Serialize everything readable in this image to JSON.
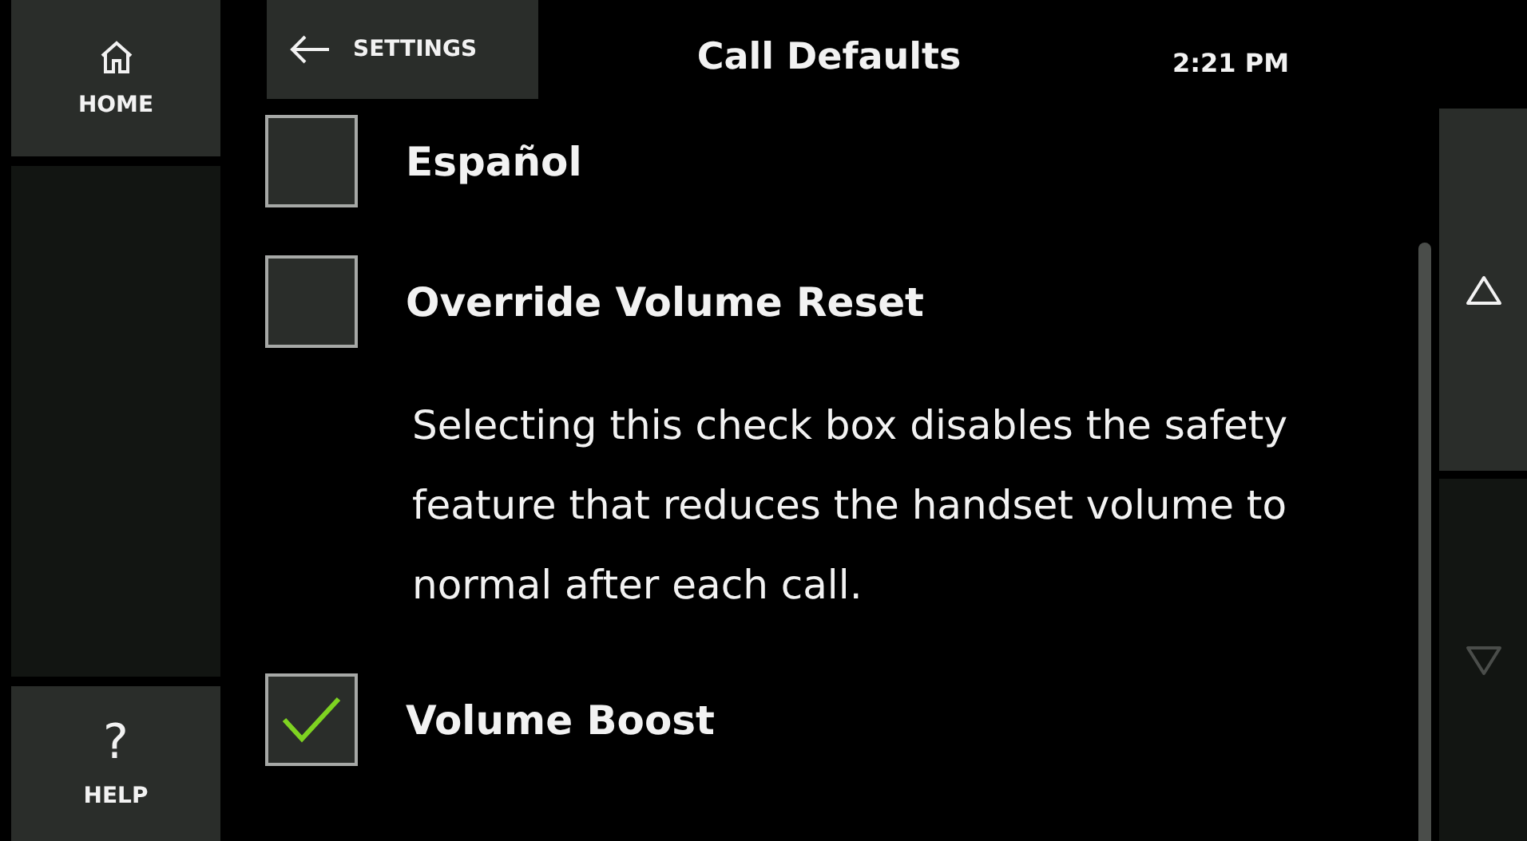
{
  "sidebar": {
    "items": [
      {
        "kind": "home",
        "label": "HOME"
      },
      {
        "kind": "help",
        "label": "HELP",
        "glyph": "?"
      }
    ]
  },
  "header": {
    "back_button": {
      "label": "SETTINGS"
    },
    "title": "Call Defaults",
    "time": "2:21 PM"
  },
  "settings": [
    {
      "kind": "checkbox",
      "label": "Español",
      "checked": false
    },
    {
      "kind": "checkbox",
      "label": "Override Volume Reset",
      "checked": false
    },
    {
      "kind": "description",
      "text": "Selecting this check box disables the safety feature that reduces the handset volume to normal after each call."
    },
    {
      "kind": "checkbox",
      "label": "Volume Boost",
      "checked": true
    }
  ],
  "scroll_buttons": [
    {
      "kind": "up",
      "disabled": false
    },
    {
      "kind": "down",
      "disabled": true
    }
  ]
}
